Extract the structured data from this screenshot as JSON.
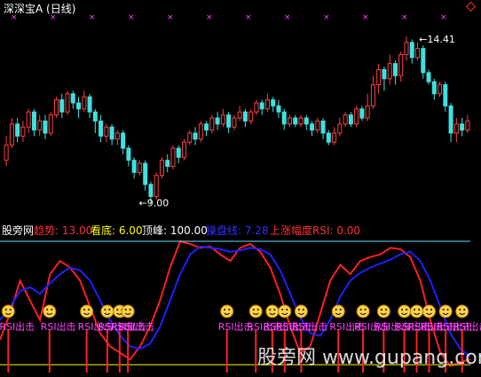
{
  "chart_data": [
    {
      "type": "candlestick",
      "title": "深深宝A (日线)",
      "price_annotations": [
        {
          "text": "14.41",
          "x": 0.89,
          "y": 14.41
        },
        {
          "text": "9.00",
          "x": 0.29,
          "y": 9.0
        }
      ],
      "ylim": [
        8.6,
        15.0
      ],
      "colors": {
        "up": "#ff4040",
        "down": "#40e0e0",
        "marker": "#ff40ff"
      },
      "candles": [
        [
          0,
          10.4,
          10.9,
          10.2,
          11.2
        ],
        [
          1,
          10.9,
          11.6,
          10.8,
          11.8
        ],
        [
          2,
          11.6,
          11.2,
          11.0,
          11.8
        ],
        [
          3,
          11.2,
          11.5,
          11.0,
          11.7
        ],
        [
          4,
          11.5,
          12.0,
          11.3,
          12.1
        ],
        [
          5,
          12.0,
          11.4,
          11.2,
          12.1
        ],
        [
          6,
          11.4,
          11.7,
          11.2,
          11.9
        ],
        [
          7,
          11.7,
          11.3,
          11.1,
          11.9
        ],
        [
          8,
          11.3,
          11.9,
          11.2,
          12.0
        ],
        [
          9,
          11.9,
          12.4,
          11.8,
          12.5
        ],
        [
          10,
          12.4,
          12.0,
          11.8,
          12.6
        ],
        [
          11,
          12.0,
          12.6,
          11.9,
          12.7
        ],
        [
          12,
          12.6,
          12.3,
          12.1,
          12.7
        ],
        [
          13,
          12.3,
          12.1,
          11.8,
          12.5
        ],
        [
          14,
          12.1,
          12.5,
          12.0,
          12.7
        ],
        [
          15,
          12.5,
          12.0,
          11.8,
          12.6
        ],
        [
          16,
          12.0,
          11.7,
          11.3,
          12.1
        ],
        [
          17,
          11.7,
          11.2,
          11.0,
          11.9
        ],
        [
          18,
          11.2,
          11.5,
          11.0,
          11.6
        ],
        [
          19,
          11.5,
          11.1,
          10.9,
          11.6
        ],
        [
          20,
          11.1,
          11.3,
          10.9,
          11.4
        ],
        [
          21,
          11.3,
          10.8,
          10.6,
          11.4
        ],
        [
          22,
          10.8,
          10.4,
          10.2,
          10.9
        ],
        [
          23,
          10.4,
          10.0,
          9.8,
          10.5
        ],
        [
          24,
          10.0,
          10.3,
          9.9,
          10.4
        ],
        [
          25,
          10.3,
          9.6,
          9.4,
          10.4
        ],
        [
          26,
          9.6,
          9.2,
          9.0,
          9.7
        ],
        [
          27,
          9.2,
          9.9,
          9.1,
          10.0
        ],
        [
          28,
          9.9,
          10.4,
          9.8,
          10.5
        ],
        [
          29,
          10.4,
          10.2,
          10.0,
          10.6
        ],
        [
          30,
          10.2,
          10.8,
          10.1,
          10.9
        ],
        [
          31,
          10.8,
          10.5,
          10.3,
          10.9
        ],
        [
          32,
          10.5,
          11.0,
          10.4,
          11.1
        ],
        [
          33,
          11.0,
          11.3,
          10.9,
          11.4
        ],
        [
          34,
          11.3,
          11.1,
          10.9,
          11.5
        ],
        [
          35,
          11.1,
          11.6,
          11.0,
          11.7
        ],
        [
          36,
          11.6,
          11.4,
          11.2,
          11.7
        ],
        [
          37,
          11.4,
          11.8,
          11.3,
          11.9
        ],
        [
          38,
          11.8,
          11.6,
          11.4,
          12.0
        ],
        [
          39,
          11.6,
          11.9,
          11.5,
          12.1
        ],
        [
          40,
          11.9,
          11.5,
          11.3,
          12.0
        ],
        [
          41,
          11.5,
          11.8,
          11.4,
          11.9
        ],
        [
          42,
          11.8,
          12.0,
          11.7,
          12.2
        ],
        [
          43,
          12.0,
          11.7,
          11.5,
          12.1
        ],
        [
          44,
          11.7,
          12.0,
          11.6,
          12.1
        ],
        [
          45,
          12.0,
          12.3,
          11.9,
          12.4
        ],
        [
          46,
          12.3,
          12.1,
          11.9,
          12.4
        ],
        [
          47,
          12.1,
          12.4,
          12.0,
          12.6
        ],
        [
          48,
          12.4,
          12.2,
          12.0,
          12.5
        ],
        [
          49,
          12.2,
          12.0,
          11.8,
          12.4
        ],
        [
          50,
          12.0,
          11.6,
          11.4,
          12.1
        ],
        [
          51,
          11.6,
          11.8,
          11.5,
          11.9
        ],
        [
          52,
          11.8,
          11.6,
          11.5,
          11.9
        ],
        [
          53,
          11.6,
          11.8,
          11.5,
          11.9
        ],
        [
          54,
          11.8,
          11.6,
          11.4,
          11.9
        ],
        [
          55,
          11.6,
          11.4,
          11.2,
          11.7
        ],
        [
          56,
          11.4,
          11.7,
          11.3,
          11.8
        ],
        [
          57,
          11.7,
          11.3,
          11.1,
          11.8
        ],
        [
          58,
          11.3,
          11.0,
          10.9,
          11.4
        ],
        [
          59,
          11.0,
          11.3,
          10.9,
          11.5
        ],
        [
          60,
          11.3,
          11.6,
          11.2,
          11.8
        ],
        [
          61,
          11.6,
          11.9,
          11.5,
          12.0
        ],
        [
          62,
          11.9,
          11.6,
          11.5,
          12.0
        ],
        [
          63,
          11.6,
          12.1,
          11.5,
          12.2
        ],
        [
          64,
          12.1,
          11.8,
          11.7,
          12.2
        ],
        [
          65,
          11.8,
          12.2,
          11.7,
          12.6
        ],
        [
          66,
          12.2,
          12.9,
          12.1,
          13.2
        ],
        [
          67,
          12.9,
          13.4,
          12.6,
          13.6
        ],
        [
          68,
          13.4,
          13.1,
          12.7,
          13.5
        ],
        [
          69,
          13.1,
          13.6,
          12.9,
          13.9
        ],
        [
          70,
          13.6,
          13.2,
          12.9,
          13.7
        ],
        [
          71,
          13.2,
          13.9,
          13.0,
          14.0
        ],
        [
          72,
          13.9,
          14.3,
          13.7,
          14.5
        ],
        [
          73,
          14.3,
          13.8,
          13.6,
          14.4
        ],
        [
          74,
          13.8,
          14.1,
          13.7,
          14.3
        ],
        [
          75,
          14.1,
          13.3,
          13.1,
          14.2
        ],
        [
          76,
          13.3,
          13.0,
          12.9,
          13.4
        ],
        [
          77,
          13.0,
          12.6,
          12.4,
          13.1
        ],
        [
          78,
          12.6,
          12.9,
          12.5,
          13.0
        ],
        [
          79,
          12.9,
          12.2,
          12.0,
          13.0
        ],
        [
          80,
          12.2,
          11.3,
          11.0,
          12.3
        ],
        [
          81,
          11.3,
          11.6,
          11.0,
          11.8
        ],
        [
          82,
          11.6,
          11.4,
          11.2,
          11.8
        ],
        [
          83,
          11.4,
          11.7,
          11.3,
          11.9
        ]
      ]
    },
    {
      "type": "line",
      "legend": [
        {
          "text": "股旁网",
          "color": "#ffffff"
        },
        {
          "text": "趋势: 13.00",
          "color": "#ff3030"
        },
        {
          "text": "看底: 6.00",
          "color": "#ffff00"
        },
        {
          "text": "顶峰: 100.00",
          "color": "#ffffff"
        },
        {
          "text": "操盘线: 7.28",
          "color": "#3030ff"
        },
        {
          "text": "上涨幅度RSI: 0.00",
          "color": "#ff3030"
        }
      ],
      "ylim": [
        0,
        100
      ],
      "series": [
        {
          "name": "趋势",
          "color": "#ff2020",
          "values": [
            25,
            45,
            70,
            55,
            40,
            75,
            85,
            80,
            70,
            50,
            30,
            20,
            15,
            10,
            20,
            35,
            55,
            80,
            100,
            98,
            95,
            96,
            90,
            85,
            95,
            98,
            92,
            80,
            60,
            35,
            15,
            20,
            45,
            70,
            82,
            75,
            85,
            88,
            90,
            95,
            94,
            88,
            70,
            40,
            15,
            5,
            8,
            10
          ]
        },
        {
          "name": "操盘线",
          "color": "#2020ff",
          "values": [
            40,
            50,
            62,
            65,
            60,
            68,
            75,
            80,
            78,
            70,
            55,
            40,
            28,
            20,
            18,
            22,
            35,
            55,
            75,
            90,
            96,
            95,
            94,
            92,
            93,
            95,
            94,
            90,
            78,
            60,
            42,
            30,
            28,
            40,
            58,
            70,
            76,
            80,
            83,
            86,
            90,
            92,
            85,
            70,
            50,
            30,
            18,
            12
          ]
        },
        {
          "name": "看底",
          "color": "#ffff00",
          "values": [
            6,
            6,
            6,
            6,
            6,
            6,
            6,
            6,
            6,
            6,
            6,
            6,
            6,
            6,
            6,
            6,
            6,
            6,
            6,
            6,
            6,
            6,
            6,
            6,
            6,
            6,
            6,
            6,
            6,
            6,
            6,
            6,
            6,
            6,
            6,
            6,
            6,
            6,
            6,
            6,
            6,
            6,
            6,
            6,
            6,
            6,
            6,
            6
          ]
        },
        {
          "name": "顶峰",
          "color": "#60e0ff",
          "values": [
            100,
            100,
            100,
            100,
            100,
            100,
            100,
            100,
            100,
            100,
            100,
            100,
            100,
            100,
            100,
            100,
            100,
            100,
            100,
            100,
            100,
            100,
            100,
            100,
            100,
            100,
            100,
            100,
            100,
            100,
            100,
            100,
            100,
            100,
            100,
            100,
            100,
            100,
            100,
            100,
            100,
            100,
            100,
            100,
            100,
            100,
            100,
            100
          ]
        }
      ],
      "signals": {
        "label": "RSI出击",
        "positions": [
          2,
          12,
          21,
          26,
          29,
          31,
          55,
          62,
          66,
          69,
          73,
          82,
          88,
          93,
          98,
          101,
          104,
          108,
          112
        ]
      }
    }
  ],
  "watermark": {
    "text": "股旁网 www.gupang.com"
  }
}
